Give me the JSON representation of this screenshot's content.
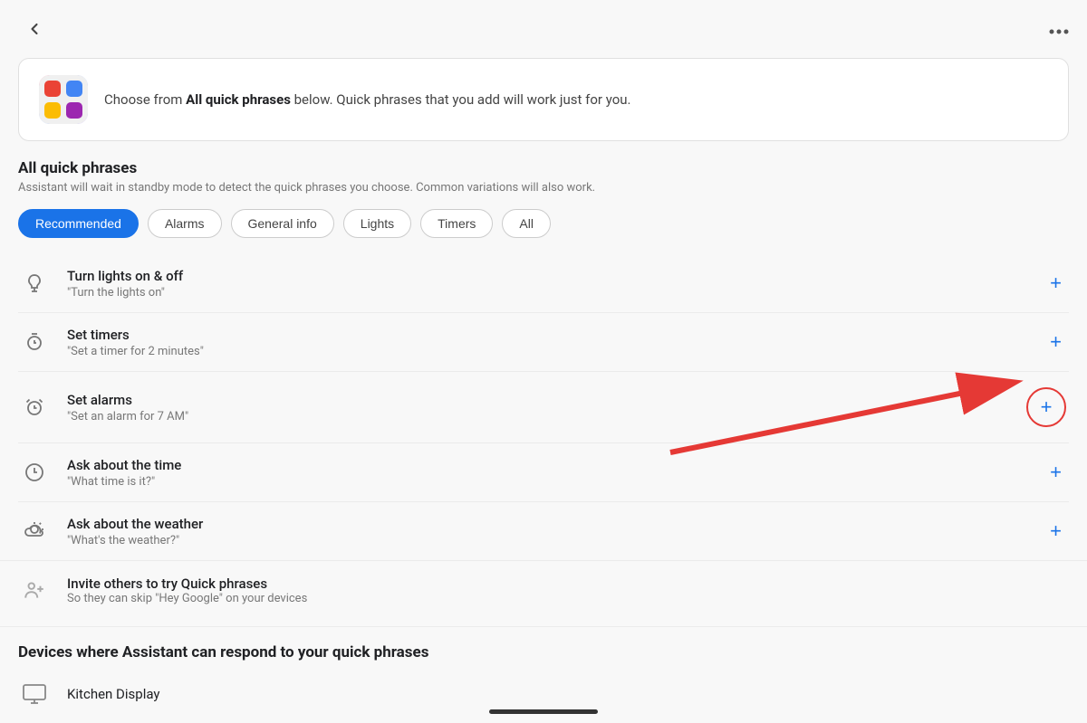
{
  "header": {
    "back_label": "‹",
    "more_label": "···"
  },
  "banner": {
    "icon_emoji": "🎨",
    "text_part1": "Choose from ",
    "text_bold": "All quick phrases",
    "text_part2": " below. Quick phrases that you add will work just for you."
  },
  "section": {
    "title": "All quick phrases",
    "subtitle": "Assistant will wait in standby mode to detect the quick phrases you choose. Common variations will also work."
  },
  "chips": [
    {
      "id": "recommended",
      "label": "Recommended",
      "active": true
    },
    {
      "id": "alarms",
      "label": "Alarms",
      "active": false
    },
    {
      "id": "general-info",
      "label": "General info",
      "active": false
    },
    {
      "id": "lights",
      "label": "Lights",
      "active": false
    },
    {
      "id": "timers",
      "label": "Timers",
      "active": false
    },
    {
      "id": "all",
      "label": "All",
      "active": false
    }
  ],
  "items": [
    {
      "id": "lights",
      "icon": "💡",
      "title": "Turn lights on & off",
      "subtitle": "\"Turn the lights on\""
    },
    {
      "id": "timers",
      "icon": "⏱",
      "title": "Set timers",
      "subtitle": "\"Set a timer for 2 minutes\""
    },
    {
      "id": "alarms",
      "icon": "⏰",
      "title": "Set alarms",
      "subtitle": "\"Set an alarm for 7 AM\""
    },
    {
      "id": "time",
      "icon": "🕐",
      "title": "Ask about the time",
      "subtitle": "\"What time is it?\""
    },
    {
      "id": "weather",
      "icon": "🌤",
      "title": "Ask about the weather",
      "subtitle": "\"What's the weather?\""
    }
  ],
  "invite": {
    "icon": "👤",
    "title": "Invite others to try Quick phrases",
    "subtitle": "So they can skip \"Hey Google\" on your devices"
  },
  "devices_section": {
    "title": "Devices where Assistant can respond to your quick phrases",
    "device": {
      "icon": "🖥",
      "label": "Kitchen Display"
    }
  },
  "add_button_label": "+"
}
